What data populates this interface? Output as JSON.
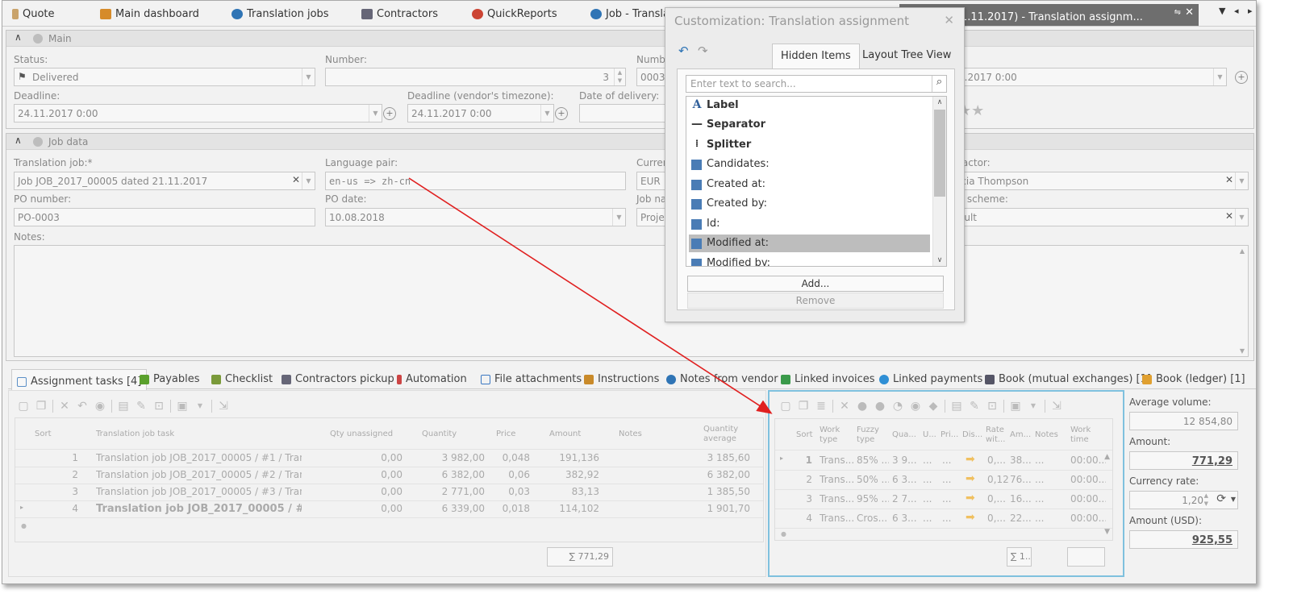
{
  "doc_tabs": [
    {
      "label": "Quote",
      "color": "#c9a36b"
    },
    {
      "label": "Main dashboard",
      "color": "#d68b2a"
    },
    {
      "label": "Translation jobs",
      "color": "#2f74b5"
    },
    {
      "label": "Contractors",
      "color": "#667"
    },
    {
      "label": "QuickReports",
      "color": "#c43"
    },
    {
      "label": "Job  - Translat",
      "color": "#2f74b5"
    }
  ],
  "active_doc_tab": "nt 0003 (21.11.2017) - Translation assignm...",
  "main_group": {
    "title": "Main",
    "status_label": "Status:",
    "status_value": "Delivered",
    "number_label": "Number:",
    "number_value": "3",
    "number2_label": "Numbe",
    "number2_value": "0003",
    "right_date_value": "1.2017 0:00",
    "deadline_label": "Deadline:",
    "deadline_value": "24.11.2017 0:00",
    "deadline_vendor_label": "Deadline (vendor's timezone):",
    "deadline_vendor_value": "24.11.2017 0:00",
    "delivery_label": "Date of delivery:",
    "delivery_value": "",
    "stars": "★★"
  },
  "job_group": {
    "title": "Job data",
    "translation_job_label": "Translation job:*",
    "translation_job_value": "Job JOB_2017_00005 dated 21.11.2017",
    "language_pair_label": "Language pair:",
    "language_pair_value": "en-us => zh-cn",
    "currency_label": "Currenc",
    "currency_value": "EUR",
    "contractor_label": "ractor:",
    "contractor_value": "icia Thompson",
    "po_number_label": "PO number:",
    "po_number_value": "PO-0003",
    "po_date_label": "PO date:",
    "po_date_value": "10.08.2018",
    "job_name_label": "Job nan",
    "job_name_value": "Project",
    "scheme_label": "y scheme:",
    "scheme_value": "ault",
    "notes_label": "Notes:"
  },
  "bottom_tabs": [
    {
      "label": "Assignment tasks [4]",
      "color": "#5b8fc7"
    },
    {
      "label": "Payables",
      "color": "#5aa02c"
    },
    {
      "label": "Checklist",
      "color": "#7a9a3a"
    },
    {
      "label": "Contractors pickup",
      "color": "#667"
    },
    {
      "label": "Automation",
      "color": "#c44"
    },
    {
      "label": "File attachments",
      "color": "#3b78c2"
    },
    {
      "label": "Instructions",
      "color": "#c98a2a"
    },
    {
      "label": "Notes from vendor",
      "color": "#2f74b5"
    },
    {
      "label": "Linked invoices",
      "color": "#3a9a4a"
    },
    {
      "label": "Linked payments",
      "color": "#2f8fd5"
    },
    {
      "label": "Book (mutual exchanges) [1]",
      "color": "#556"
    },
    {
      "label": "Book (ledger) [1]",
      "color": "#e0a030"
    }
  ],
  "tasks_grid": {
    "headers": [
      "Sort",
      "Translation job task",
      "Qty unassigned",
      "Quantity",
      "Price",
      "Amount",
      "Notes",
      "Quantity average"
    ],
    "rows": [
      {
        "sort": "1",
        "task": "Translation job JOB_2017_00005 / #1 / Trans...",
        "qty_unassigned": "0,00",
        "quantity": "3 982,00",
        "price": "0,048",
        "amount": "191,136",
        "avg": "3 185,60"
      },
      {
        "sort": "2",
        "task": "Translation job JOB_2017_00005 / #2 / Tran...",
        "qty_unassigned": "0,00",
        "quantity": "6 382,00",
        "price": "0,06",
        "amount": "382,92",
        "avg": "6 382,00"
      },
      {
        "sort": "3",
        "task": "Translation job JOB_2017_00005 / #3 / Tran...",
        "qty_unassigned": "0,00",
        "quantity": "2 771,00",
        "price": "0,03",
        "amount": "83,13",
        "avg": "1 385,50"
      },
      {
        "sort": "4",
        "task": "Translation job JOB_2017_00005 / #4...",
        "qty_unassigned": "0,00",
        "quantity": "6 339,00",
        "price": "0,018",
        "amount": "114,102",
        "avg": "1 901,70"
      }
    ],
    "total": "∑ 771,29"
  },
  "work_grid": {
    "headers": [
      "Sort",
      "Work type",
      "Fuzzy type",
      "Qua...",
      "U...",
      "Pri...",
      "Dis...",
      "Rate wit...",
      "Am...",
      "Notes",
      "Work time"
    ],
    "rows": [
      {
        "sort": "1",
        "work": "Trans...",
        "fuzzy": "85% ...",
        "qua": "3 9...",
        "u": "...",
        "pri": "...",
        "rate": "0,...",
        "am": "38...",
        "notes": "...",
        "time": "00:00..."
      },
      {
        "sort": "2",
        "work": "Trans...",
        "fuzzy": "50% ...",
        "qua": "6 3...",
        "u": "...",
        "pri": "...",
        "rate": "0,12",
        "am": "76...",
        "notes": "...",
        "time": "00:00..."
      },
      {
        "sort": "3",
        "work": "Trans...",
        "fuzzy": "95% ...",
        "qua": "2 7...",
        "u": "...",
        "pri": "...",
        "rate": "0,...",
        "am": "16...",
        "notes": "...",
        "time": "00:00..."
      },
      {
        "sort": "4",
        "work": "Trans...",
        "fuzzy": "Cros...",
        "qua": "6 3...",
        "u": "...",
        "pri": "...",
        "rate": "0,...",
        "am": "22...",
        "notes": "...",
        "time": "00:00..."
      }
    ],
    "total": "∑ 1..."
  },
  "side": {
    "avg_volume_label": "Average volume:",
    "avg_volume_value": "12 854,80",
    "amount_label": "Amount:",
    "amount_value": "771,29",
    "currency_rate_label": "Currency rate:",
    "currency_rate_value": "1,20",
    "amount_usd_label": "Amount (USD):",
    "amount_usd_value": "925,55"
  },
  "customization": {
    "title": "Customization: Translation assignment",
    "tab_hidden": "Hidden Items",
    "tab_layout": "Layout Tree View",
    "search_placeholder": "Enter text to search...",
    "items": [
      {
        "label": "Label",
        "kind": "label"
      },
      {
        "label": "Separator",
        "kind": "separator"
      },
      {
        "label": "Splitter",
        "kind": "splitter"
      },
      {
        "label": "Candidates:",
        "kind": "field"
      },
      {
        "label": "Created at:",
        "kind": "field"
      },
      {
        "label": "Created by:",
        "kind": "field"
      },
      {
        "label": "Id:",
        "kind": "field"
      },
      {
        "label": "Modified at:",
        "kind": "field"
      },
      {
        "label": "Modified by:",
        "kind": "field"
      }
    ],
    "add_label": "Add...",
    "remove_label": "Remove"
  },
  "colors": {
    "accent_field": "#4a7cb5",
    "arrow": "#e02020",
    "work_grid_border": "#7fc1de"
  }
}
